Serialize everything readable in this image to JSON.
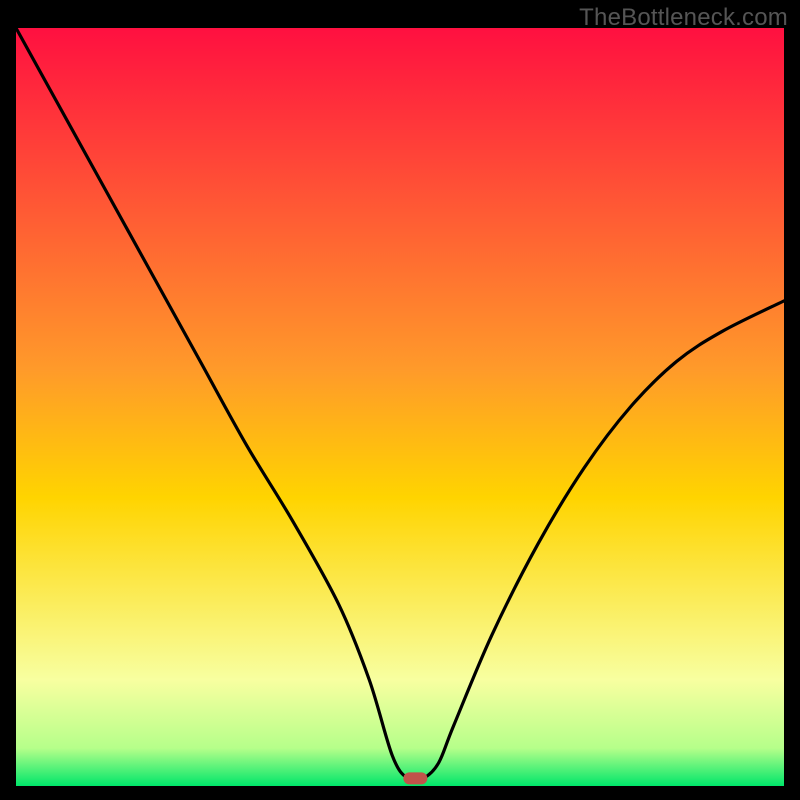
{
  "watermark": "TheBottleneck.com",
  "chart_data": {
    "type": "line",
    "title": "",
    "xlabel": "",
    "ylabel": "",
    "xlim": [
      0,
      100
    ],
    "ylim": [
      0,
      100
    ],
    "series": [
      {
        "name": "curve",
        "x": [
          0,
          6,
          12,
          18,
          24,
          30,
          36,
          42,
          46,
          49,
          51,
          53,
          55,
          57,
          62,
          68,
          74,
          80,
          86,
          92,
          100
        ],
        "y": [
          100,
          89,
          78,
          67,
          56,
          45,
          35,
          24,
          14,
          4,
          1,
          1,
          3,
          8,
          20,
          32,
          42,
          50,
          56,
          60,
          64
        ]
      }
    ],
    "marker": {
      "x": 52,
      "y": 1
    },
    "background": "red-yellow-green-vertical-gradient"
  },
  "colors": {
    "gradient_top": "#ff1040",
    "gradient_mid": "#ffd400",
    "gradient_low": "#f8ffa0",
    "gradient_bottom": "#00e66a",
    "curve": "#000000",
    "marker_fill": "#c1534a",
    "frame": "#000000"
  }
}
